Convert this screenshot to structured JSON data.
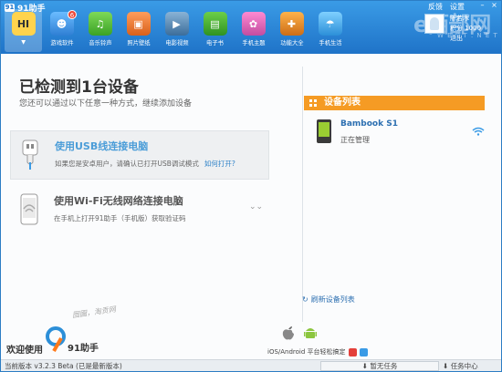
{
  "app": {
    "title": "91助手"
  },
  "toolbar": {
    "items": [
      {
        "label": "",
        "icon": "home-icon"
      },
      {
        "label": "游戏软件",
        "icon": "games-icon",
        "badge": "6"
      },
      {
        "label": "音乐铃声",
        "icon": "music-icon"
      },
      {
        "label": "照片壁纸",
        "icon": "photo-icon"
      },
      {
        "label": "电影视频",
        "icon": "video-icon"
      },
      {
        "label": "电子书",
        "icon": "ebook-icon"
      },
      {
        "label": "手机主题",
        "icon": "theme-icon"
      },
      {
        "label": "功能大全",
        "icon": "toolbox-icon"
      },
      {
        "label": "手机生活",
        "icon": "life-icon"
      }
    ],
    "feedback": "反馈",
    "settings": "设置"
  },
  "user": {
    "name": "陈若木",
    "points": "积分 1000",
    "logout": "退出"
  },
  "watermark": {
    "big": "e西部网",
    "small": "W E S T . N E T"
  },
  "main": {
    "heading": "已检测到1台设备",
    "subheading": "您还可以通过以下任意一种方式，继续添加设备",
    "usb": {
      "title": "使用USB线连接电脑",
      "desc": "如果您是安卓用户，请确认已打开USB调试模式",
      "link": "如何打开?"
    },
    "wifi": {
      "title": "使用Wi-Fi无线网络连接电脑",
      "desc": "在手机上打开91助手（手机版）获取验证码",
      "expand": "»"
    },
    "welcome": "欢迎使用",
    "brand": "91助手",
    "handwriting": "囫圇，淘贡网",
    "os_text": "iOS/Android 平台轻松搞定"
  },
  "devices": {
    "header": "设备列表",
    "list": [
      {
        "name": "Bambook S1",
        "status": "正在管理"
      }
    ],
    "refresh": "刷新设备列表"
  },
  "statusbar": {
    "version": "当前版本 v3.2.3 Beta (已是最新版本)",
    "task": "暂无任务",
    "task_center": "任务中心"
  },
  "colors": {
    "accent": "#1f73c8",
    "orange": "#f59b24",
    "link": "#2e82c8"
  }
}
